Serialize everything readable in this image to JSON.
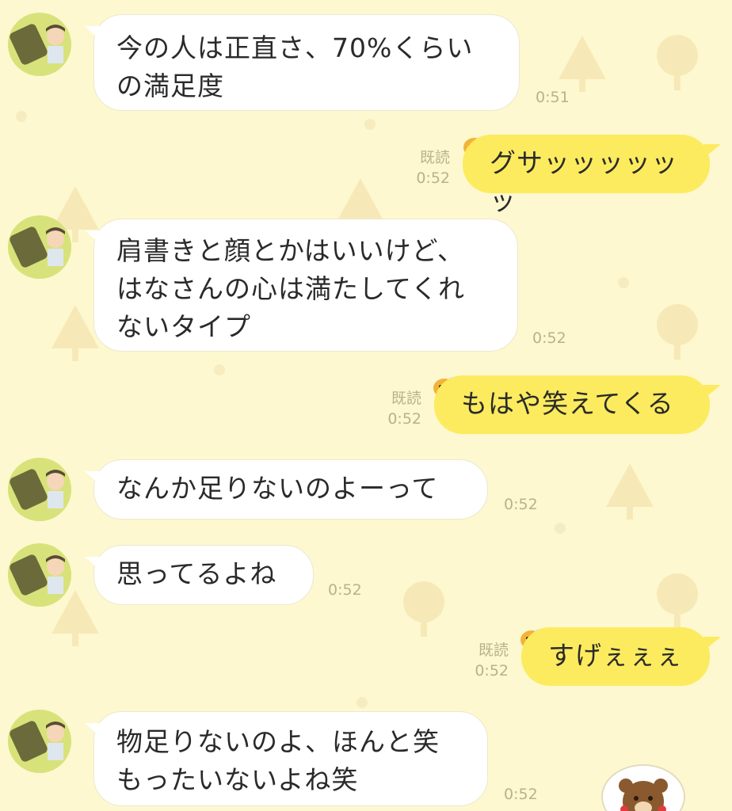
{
  "colors": {
    "background": "#fdf8cf",
    "incoming_bubble": "#ffffff",
    "outgoing_bubble": "#fceb5e",
    "meta_text": "#b9b28a"
  },
  "messages": [
    {
      "direction": "in",
      "text": "今の人は正直さ、70%くらい\nの満足度",
      "time": "0:51"
    },
    {
      "direction": "out",
      "text": "グサッッッッッッ",
      "read": "既読",
      "time": "0:52"
    },
    {
      "direction": "in",
      "text": "肩書きと顔とかはいいけど、\nはなさんの心は満たしてくれ\nないタイプ",
      "time": "0:52"
    },
    {
      "direction": "out",
      "text": "もはや笑えてくる",
      "read": "既読",
      "time": "0:52"
    },
    {
      "direction": "in",
      "text": "なんか足りないのよーって",
      "time": "0:52"
    },
    {
      "direction": "in",
      "text": "思ってるよね",
      "time": "0:52"
    },
    {
      "direction": "out",
      "text": "すげぇぇぇ",
      "read": "既読",
      "time": "0:52"
    },
    {
      "direction": "in",
      "text": "物足りないのよ、ほんと笑\nもったいないよね笑",
      "time": "0:52"
    }
  ]
}
